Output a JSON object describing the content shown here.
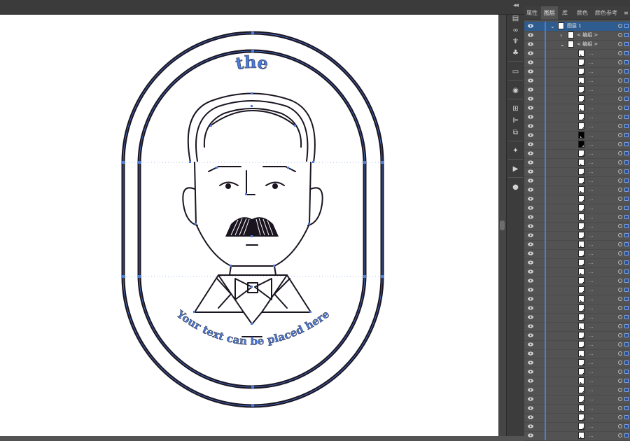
{
  "panel": {
    "tabs": [
      {
        "label": "属性"
      },
      {
        "label": "图层"
      },
      {
        "label": "库"
      },
      {
        "label": "颜色"
      },
      {
        "label": "颜色参考"
      }
    ],
    "active_tab": "图层",
    "layer_name": "图层 1",
    "group_label": "< 编组 >",
    "sublayer_count": 43,
    "row_dots": "..."
  },
  "artboard": {
    "top_text": "the",
    "bottom_text": "Your text can be placed here"
  },
  "colors": {
    "panel_bg": "#535353",
    "selection_blue": "#4a7cdb",
    "ink": "#1a1420"
  }
}
